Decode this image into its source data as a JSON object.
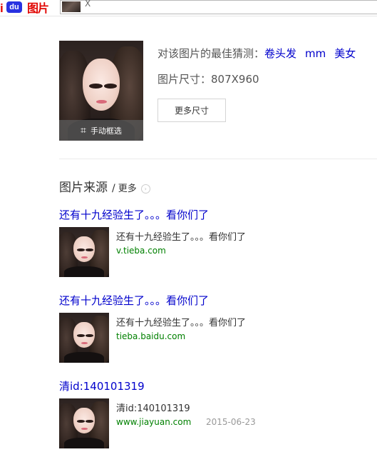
{
  "header": {
    "logo_text": "图片",
    "logo_mark": "du",
    "chip_close": "X"
  },
  "result": {
    "crop_label": "手动框选",
    "guess_label": "对该图片的最佳猜测：",
    "guess_tags": [
      "卷头发",
      "mm",
      "美女"
    ],
    "size_label": "图片尺寸：807X960",
    "more_sizes_button": "更多尺寸"
  },
  "sources": {
    "title": "图片来源",
    "slash": "/",
    "more": "更多",
    "items": [
      {
        "title": "还有十九经验生了。。。看你们了",
        "text": "还有十九经验生了。。。看你们了",
        "url": "v.tieba.com",
        "date": ""
      },
      {
        "title": "还有十九经验生了。。。看你们了",
        "text": "还有十九经验生了。。。看你们了",
        "url": "tieba.baidu.com",
        "date": ""
      },
      {
        "title": "清id:140101319",
        "text": "清id:140101319",
        "url": "www.jiayuan.com",
        "date": "2015-06-23"
      }
    ]
  },
  "icons": {
    "crop": "crop-icon",
    "more_arrow": "chevron-right-circle-icon",
    "logo": "baidu-paw-icon"
  },
  "colors": {
    "link_blue": "#0000cc",
    "url_green": "#008000",
    "brand_red": "#e10602",
    "brand_blue": "#2932e1"
  }
}
